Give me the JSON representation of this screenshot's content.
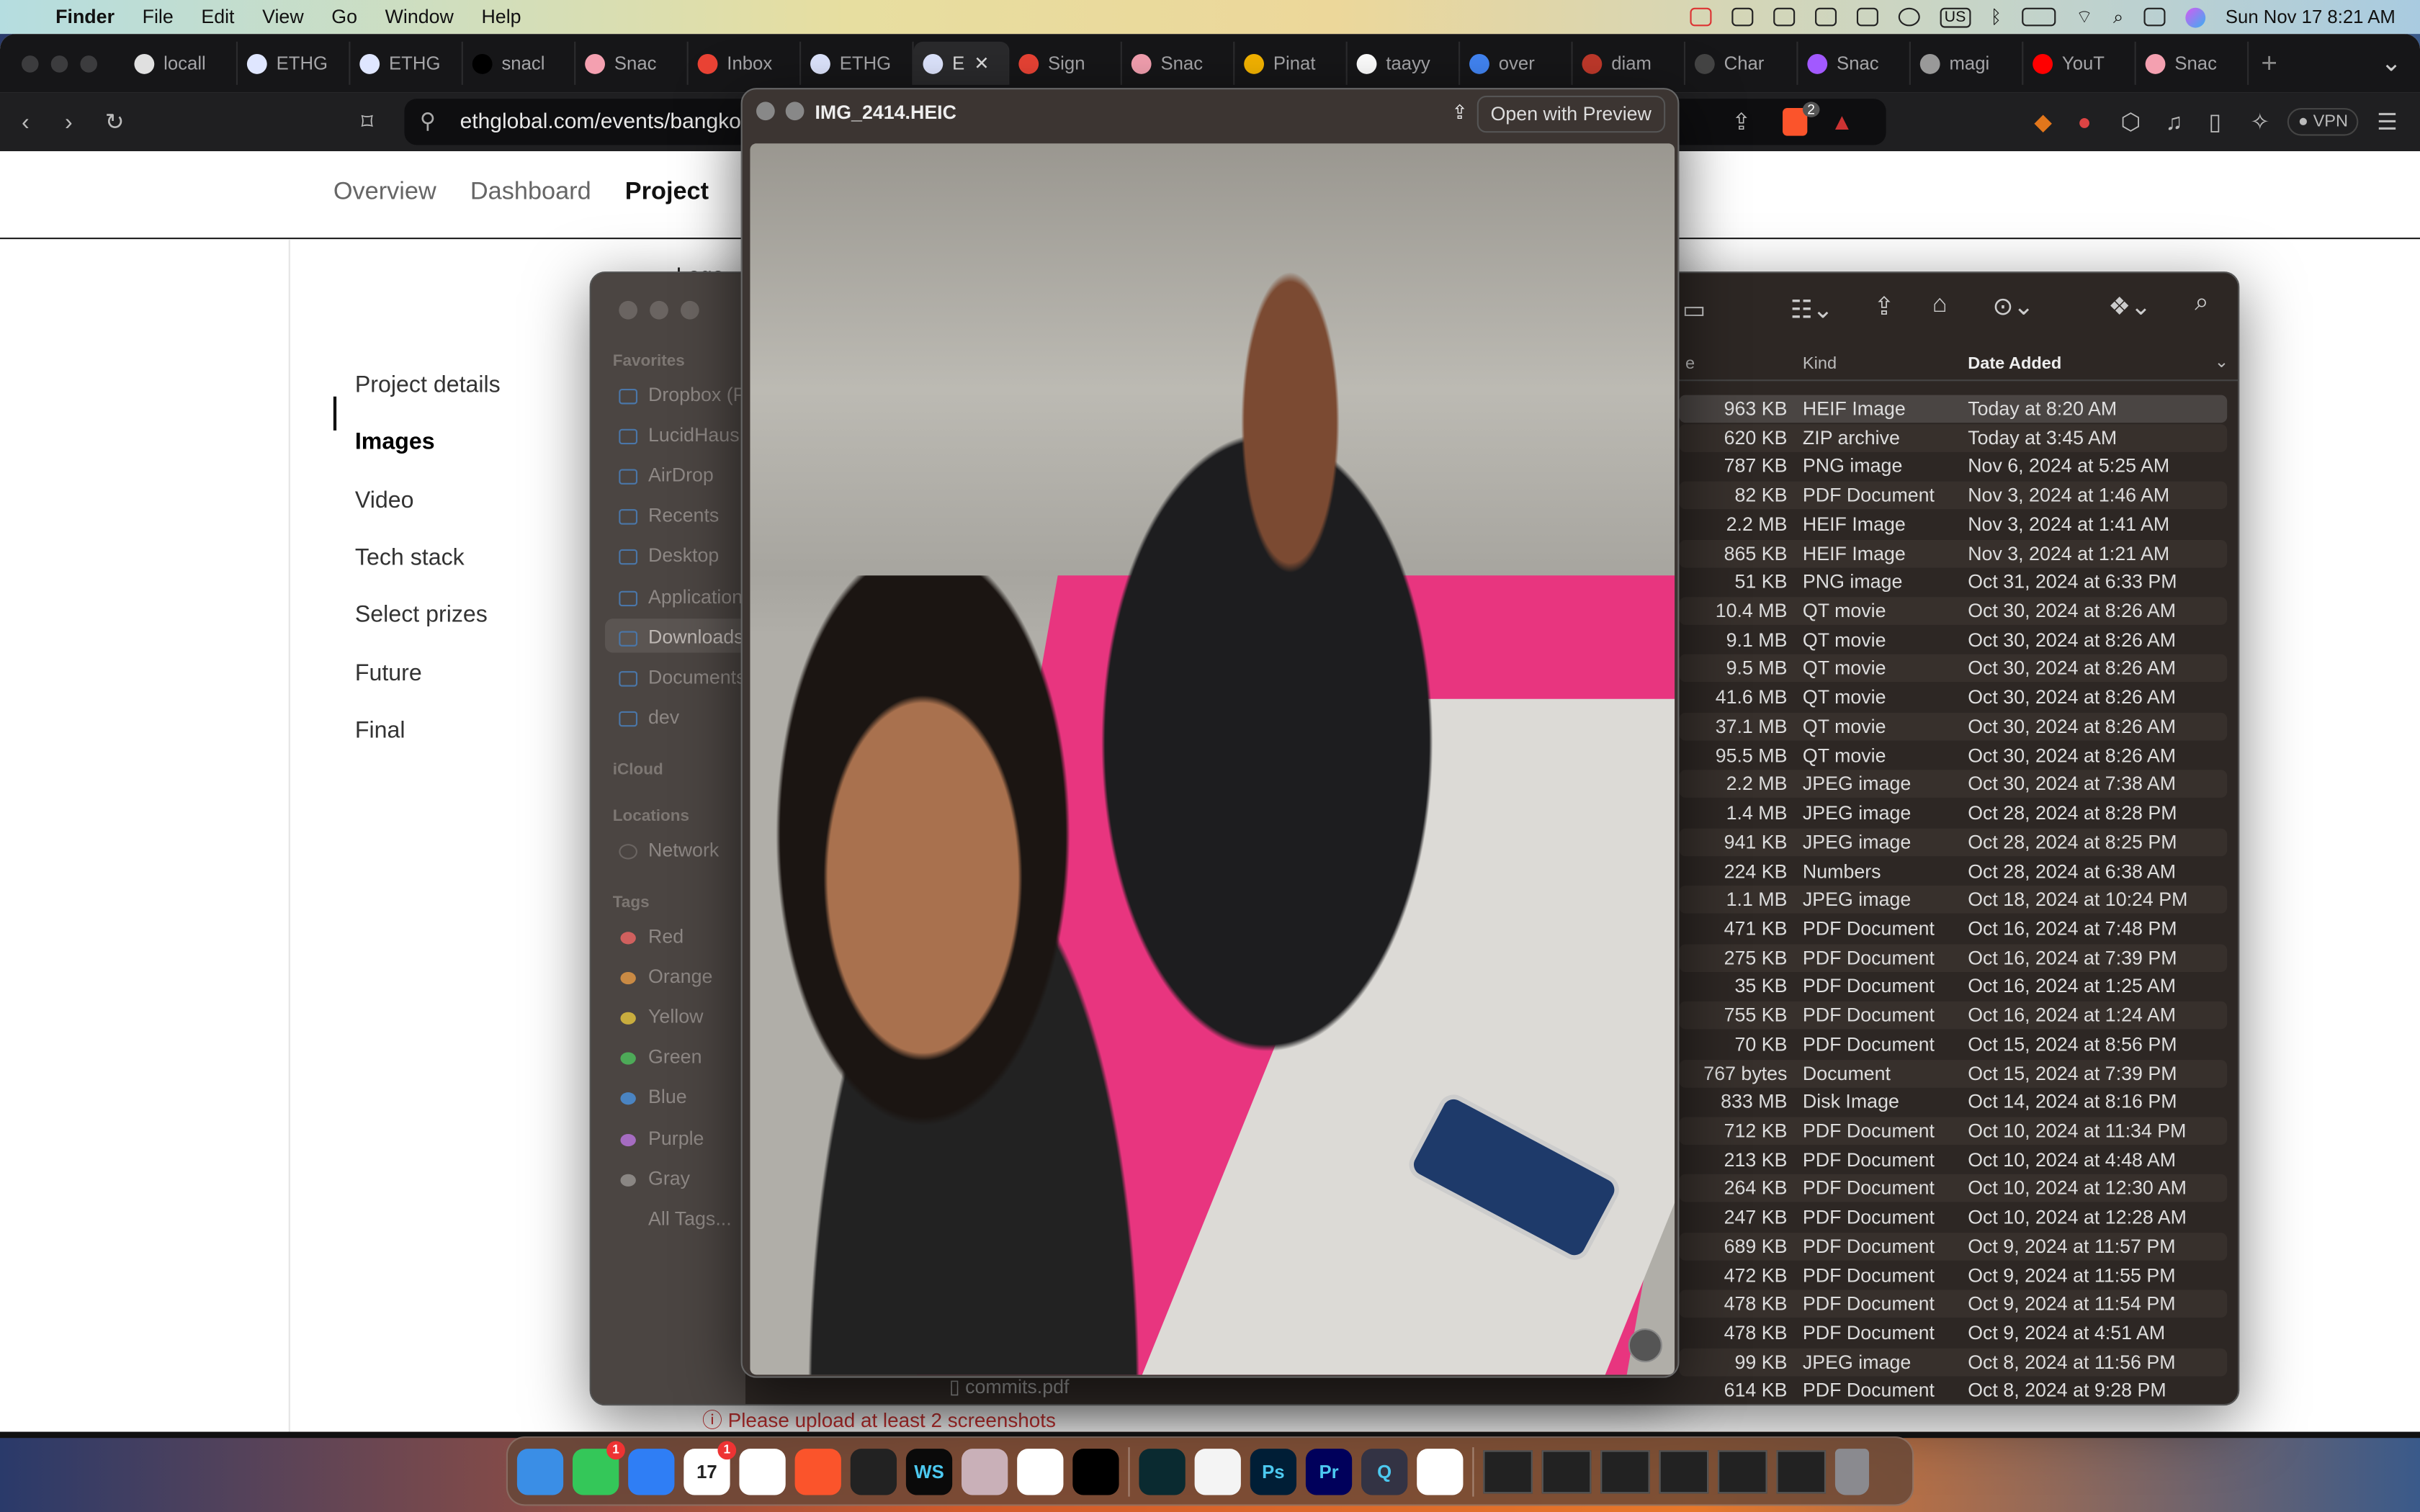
{
  "menubar": {
    "app": "Finder",
    "items": [
      "File",
      "Edit",
      "View",
      "Go",
      "Window",
      "Help"
    ],
    "keyboard": "US",
    "datetime": "Sun Nov 17  8:21 AM"
  },
  "browser": {
    "tabs": [
      {
        "label": "locall",
        "color": "#e0e0e0"
      },
      {
        "label": "ETHG",
        "color": "#dfe6ff"
      },
      {
        "label": "ETHG",
        "color": "#dfe6ff"
      },
      {
        "label": "snacl",
        "color": "#000000"
      },
      {
        "label": "Snac",
        "color": "#f4a0b0"
      },
      {
        "label": "Inbox",
        "color": "#ea4335"
      },
      {
        "label": "ETHG",
        "color": "#dfe6ff"
      },
      {
        "label": "E",
        "color": "#dfe6ff",
        "active": true
      },
      {
        "label": "Sign",
        "color": "#ea4335"
      },
      {
        "label": "Snac",
        "color": "#f4a0b0"
      },
      {
        "label": "Pinat",
        "color": "#f5b400"
      },
      {
        "label": "taayy",
        "color": "#ffffff"
      },
      {
        "label": "over",
        "color": "#4285f4"
      },
      {
        "label": "diam",
        "color": "#c0392b"
      },
      {
        "label": "Char",
        "color": "#444444"
      },
      {
        "label": "Snac",
        "color": "#a259ff"
      },
      {
        "label": "magi",
        "color": "#999999"
      },
      {
        "label": "YouT",
        "color": "#ff0000"
      },
      {
        "label": "Snac",
        "color": "#f4a0b0"
      }
    ],
    "url": "ethglobal.com/events/bangkok",
    "vpn": "VPN",
    "brave_badge": "2"
  },
  "page": {
    "nav": [
      "Overview",
      "Dashboard",
      "Project"
    ],
    "logo_label": "Logo",
    "sidebar": [
      "Project details",
      "Images",
      "Video",
      "Tech stack",
      "Select prizes",
      "Future",
      "Final"
    ],
    "active": "Images",
    "warning": "Please upload at least 2 screenshots"
  },
  "quicklook": {
    "filename": "IMG_2414.HEIC",
    "open_with": "Open with Preview"
  },
  "finder": {
    "favorites_header": "Favorites",
    "favorites": [
      "Dropbox (P",
      "LucidHaus",
      "AirDrop",
      "Recents",
      "Desktop",
      "Applications",
      "Downloads",
      "Documents",
      "dev"
    ],
    "selected": "Downloads",
    "icloud_header": "iCloud",
    "locations_header": "Locations",
    "locations": [
      "Network"
    ],
    "tags_header": "Tags",
    "tags": [
      {
        "name": "Red",
        "color": "#d0605e"
      },
      {
        "name": "Orange",
        "color": "#c98a44"
      },
      {
        "name": "Yellow",
        "color": "#c9ad3e"
      },
      {
        "name": "Green",
        "color": "#4daa58"
      },
      {
        "name": "Blue",
        "color": "#4a84c2"
      },
      {
        "name": "Purple",
        "color": "#a56cc1"
      },
      {
        "name": "Gray",
        "color": "#8a8683"
      }
    ],
    "all_tags": "All Tags...",
    "columns": {
      "size": "e",
      "kind": "Kind",
      "date": "Date Added"
    },
    "partial_file": "commits.pdf",
    "files": [
      [
        "963 KB",
        "HEIF Image",
        "Today at 8:20 AM"
      ],
      [
        "620 KB",
        "ZIP archive",
        "Today at 3:45 AM"
      ],
      [
        "787 KB",
        "PNG image",
        "Nov 6, 2024 at 5:25 AM"
      ],
      [
        "82 KB",
        "PDF Document",
        "Nov 3, 2024 at 1:46 AM"
      ],
      [
        "2.2 MB",
        "HEIF Image",
        "Nov 3, 2024 at 1:41 AM"
      ],
      [
        "865 KB",
        "HEIF Image",
        "Nov 3, 2024 at 1:21 AM"
      ],
      [
        "51 KB",
        "PNG image",
        "Oct 31, 2024 at 6:33 PM"
      ],
      [
        "10.4 MB",
        "QT movie",
        "Oct 30, 2024 at 8:26 AM"
      ],
      [
        "9.1 MB",
        "QT movie",
        "Oct 30, 2024 at 8:26 AM"
      ],
      [
        "9.5 MB",
        "QT movie",
        "Oct 30, 2024 at 8:26 AM"
      ],
      [
        "41.6 MB",
        "QT movie",
        "Oct 30, 2024 at 8:26 AM"
      ],
      [
        "37.1 MB",
        "QT movie",
        "Oct 30, 2024 at 8:26 AM"
      ],
      [
        "95.5 MB",
        "QT movie",
        "Oct 30, 2024 at 8:26 AM"
      ],
      [
        "2.2 MB",
        "JPEG image",
        "Oct 30, 2024 at 7:38 AM"
      ],
      [
        "1.4 MB",
        "JPEG image",
        "Oct 28, 2024 at 8:28 PM"
      ],
      [
        "941 KB",
        "JPEG image",
        "Oct 28, 2024 at 8:25 PM"
      ],
      [
        "224 KB",
        "Numbers",
        "Oct 28, 2024 at 6:38 AM"
      ],
      [
        "1.1 MB",
        "JPEG image",
        "Oct 18, 2024 at 10:24 PM"
      ],
      [
        "471 KB",
        "PDF Document",
        "Oct 16, 2024 at 7:48 PM"
      ],
      [
        "275 KB",
        "PDF Document",
        "Oct 16, 2024 at 7:39 PM"
      ],
      [
        "35 KB",
        "PDF Document",
        "Oct 16, 2024 at 1:25 AM"
      ],
      [
        "755 KB",
        "PDF Document",
        "Oct 16, 2024 at 1:24 AM"
      ],
      [
        "70 KB",
        "PDF Document",
        "Oct 15, 2024 at 8:56 PM"
      ],
      [
        "767 bytes",
        "Document",
        "Oct 15, 2024 at 7:39 PM"
      ],
      [
        "833 MB",
        "Disk Image",
        "Oct 14, 2024 at 8:16 PM"
      ],
      [
        "712 KB",
        "PDF Document",
        "Oct 10, 2024 at 11:34 PM"
      ],
      [
        "213 KB",
        "PDF Document",
        "Oct 10, 2024 at 4:48 AM"
      ],
      [
        "264 KB",
        "PDF Document",
        "Oct 10, 2024 at 12:30 AM"
      ],
      [
        "247 KB",
        "PDF Document",
        "Oct 10, 2024 at 12:28 AM"
      ],
      [
        "689 KB",
        "PDF Document",
        "Oct 9, 2024 at 11:57 PM"
      ],
      [
        "472 KB",
        "PDF Document",
        "Oct 9, 2024 at 11:55 PM"
      ],
      [
        "478 KB",
        "PDF Document",
        "Oct 9, 2024 at 11:54 PM"
      ],
      [
        "478 KB",
        "PDF Document",
        "Oct 9, 2024 at 4:51 AM"
      ],
      [
        "99 KB",
        "JPEG image",
        "Oct 8, 2024 at 11:56 PM"
      ],
      [
        "614 KB",
        "PDF Document",
        "Oct 8, 2024 at 9:28 PM"
      ]
    ]
  },
  "dock": {
    "apps": [
      {
        "name": "finder",
        "color": "#3a8ee6"
      },
      {
        "name": "messages",
        "color": "#34c759",
        "badge": "1"
      },
      {
        "name": "mail",
        "color": "#2f7ef5"
      },
      {
        "name": "calendar",
        "color": "#ffffff",
        "text": "17",
        "badge": "1"
      },
      {
        "name": "slack",
        "color": "#ffffff"
      },
      {
        "name": "brave",
        "color": "#fb542b"
      },
      {
        "name": "linear",
        "color": "#222222"
      },
      {
        "name": "webstorm",
        "color": "#0a0a0a",
        "text": "WS"
      },
      {
        "name": "app-pink",
        "color": "#c9b0b8"
      },
      {
        "name": "freeform",
        "color": "#ffffff"
      },
      {
        "name": "skull-app",
        "color": "#000000"
      }
    ],
    "apps2": [
      {
        "name": "perplexity",
        "color": "#0a2a30"
      },
      {
        "name": "textedit",
        "color": "#f4f4f4"
      },
      {
        "name": "photoshop",
        "color": "#001e36",
        "text": "Ps"
      },
      {
        "name": "premiere",
        "color": "#00005b",
        "text": "Pr"
      },
      {
        "name": "quicktime",
        "color": "#333344",
        "text": "Q"
      },
      {
        "name": "photos",
        "color": "#ffffff"
      }
    ],
    "windows": 6,
    "trash": "trash"
  }
}
